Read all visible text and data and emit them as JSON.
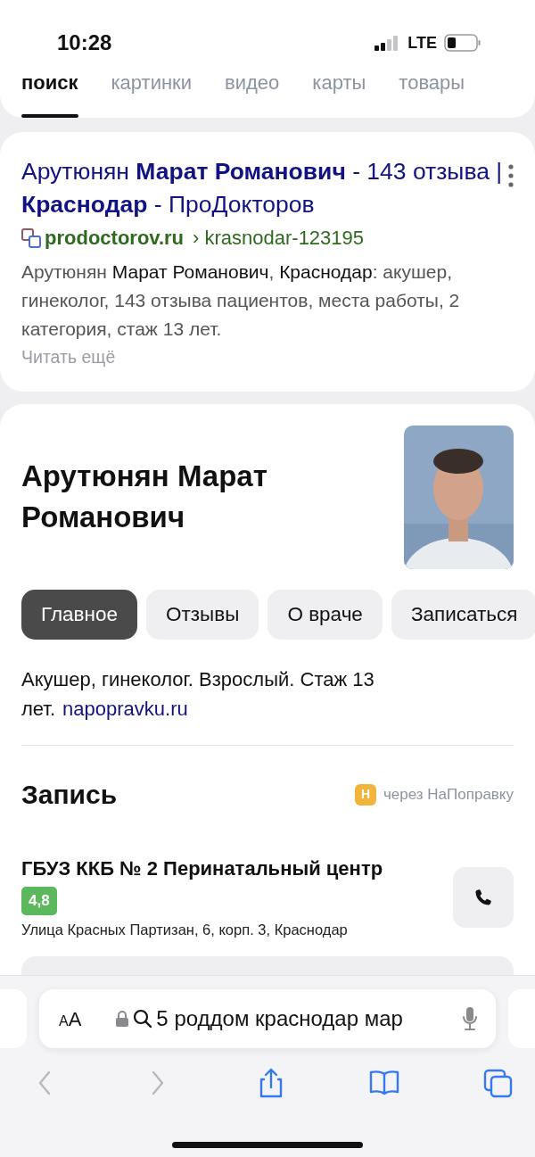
{
  "status_bar": {
    "time": "10:28",
    "network": "LTE"
  },
  "search_tabs": [
    {
      "label": "поиск",
      "selected": true
    },
    {
      "label": "картинки",
      "selected": false
    },
    {
      "label": "видео",
      "selected": false
    },
    {
      "label": "карты",
      "selected": false
    },
    {
      "label": "товары",
      "selected": false
    }
  ],
  "result": {
    "title": "Арутюнян **Марат Романович** - 143 отзыва | **Краснодар** - ПроДокторов",
    "domain": "prodoctorov.ru",
    "path": "› krasnodar-123195",
    "snippet": "Арутюнян **Марат Романович**, **Краснодар**: акушер, гинеколог, 143 отзыва пациентов, места работы, 2 категория, стаж 13 лет.",
    "more": "Читать ещё"
  },
  "doctor_card": {
    "name": "Арутюнян Марат Романович",
    "chips": [
      {
        "label": "Главное",
        "selected": true
      },
      {
        "label": "Отзывы",
        "selected": false
      },
      {
        "label": "О враче",
        "selected": false
      },
      {
        "label": "Записаться",
        "selected": false
      }
    ],
    "description": "Акушер, гинеколог. Взрослый. Стаж 13 лет.",
    "source_link": "napopravku.ru",
    "booking": {
      "heading": "Запись",
      "provider_badge": "Н",
      "provider": "через НаПоправку",
      "clinic": "ГБУЗ ККБ № 2 Перинатальный центр",
      "rating": "4,8",
      "address": "Улица Красных Партизан, 6, корп. 3, Краснодар"
    }
  },
  "browser_bar": {
    "text_size": "AA",
    "query": "5 роддом краснодар мар",
    "toolbar": [
      {
        "kind": "back",
        "disabled": true
      },
      {
        "kind": "forward",
        "disabled": true
      },
      {
        "kind": "share",
        "disabled": false
      },
      {
        "kind": "bookmarks",
        "disabled": false
      },
      {
        "kind": "tabs",
        "disabled": false
      }
    ]
  }
}
